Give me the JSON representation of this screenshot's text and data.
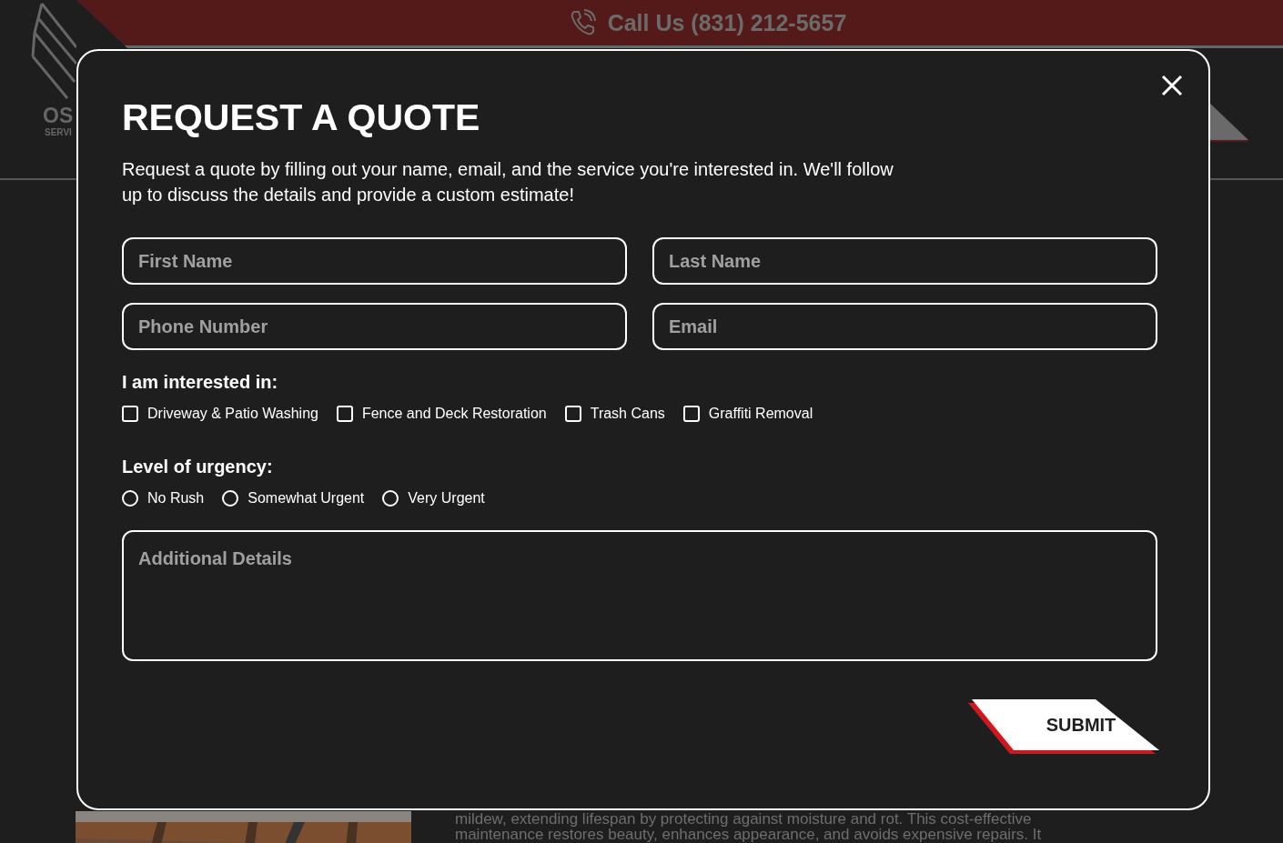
{
  "header": {
    "call_us": "Call Us (831) 212-5657",
    "logo_text": "OS",
    "logo_subtext": "SERVI"
  },
  "page": {
    "photo": {
      "kind": "picture"
    },
    "body_lines": [
      "mildew, extending lifespan by protecting against moisture and rot. This cost-effective",
      "maintenance restores beauty, enhances appearance, and avoids expensive repairs. It"
    ]
  },
  "modal": {
    "title": "REQUEST A QUOTE",
    "description": "Request a quote by filling out your name, email, and the service you're interested in. We'll follow up to discuss the details and provide a custom estimate!",
    "fields": [
      {
        "placeholder": "First Name"
      },
      {
        "placeholder": "Last Name"
      },
      {
        "placeholder": "Phone Number"
      },
      {
        "placeholder": "Email"
      }
    ],
    "services_label": "I am interested in:",
    "services": [
      {
        "label": "Driveway & Patio Washing",
        "checked": false
      },
      {
        "label": "Fence and Deck Restoration",
        "checked": false
      },
      {
        "label": "Trash Cans",
        "checked": false
      },
      {
        "label": "Graffiti Removal",
        "checked": false
      }
    ],
    "urgency_label": "Level of urgency:",
    "urgency": [
      {
        "label": "No Rush",
        "selected": false
      },
      {
        "label": "Somewhat Urgent",
        "selected": false
      },
      {
        "label": "Very Urgent",
        "selected": false
      }
    ],
    "details": {
      "placeholder": "Additional Details"
    },
    "submit": "SUBMIT"
  }
}
